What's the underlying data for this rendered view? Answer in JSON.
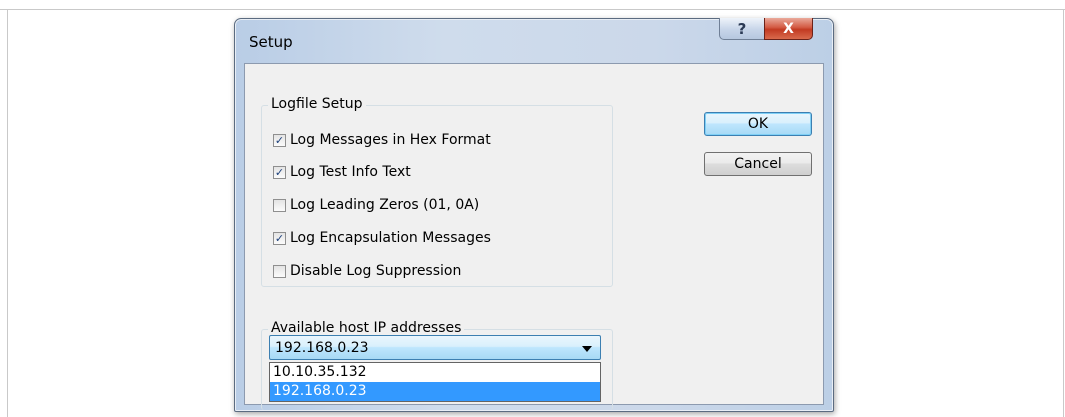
{
  "window": {
    "title": "Setup"
  },
  "title_buttons": {
    "help": "?",
    "close": "X"
  },
  "logfile_group": {
    "label": "Logfile Setup",
    "options": [
      {
        "label": "Log Messages in Hex Format",
        "checked": true,
        "mark": "✓"
      },
      {
        "label": "Log Test Info Text",
        "checked": true,
        "mark": "✓"
      },
      {
        "label": "Log Leading Zeros (01, 0A)",
        "checked": false,
        "mark": ""
      },
      {
        "label": "Log Encapsulation Messages",
        "checked": true,
        "mark": "✓"
      },
      {
        "label": "Disable Log Suppression",
        "checked": false,
        "mark": ""
      }
    ]
  },
  "buttons": {
    "ok": "OK",
    "cancel": "Cancel"
  },
  "host_group": {
    "label": "Available host IP addresses",
    "selected": "192.168.0.23",
    "options": [
      "10.10.35.132",
      "192.168.0.23"
    ]
  }
}
